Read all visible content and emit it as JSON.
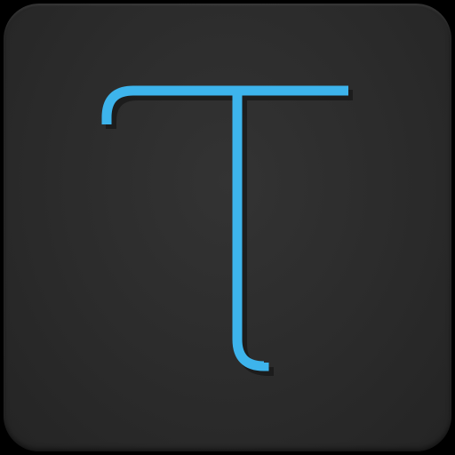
{
  "app_icon": {
    "name": "typography-app-icon",
    "glyph": "T",
    "colors": {
      "background": "#2b2b2b",
      "glyph": "#3db4ec",
      "glyph_shadow": "#111111"
    }
  }
}
